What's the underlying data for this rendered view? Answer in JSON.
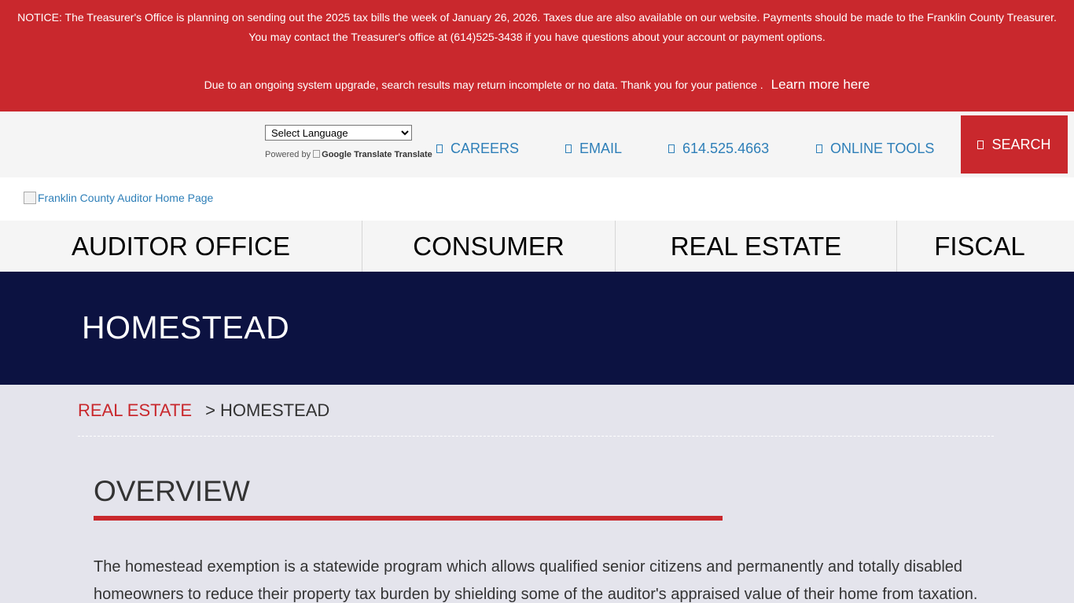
{
  "notice": {
    "line1": "NOTICE: The Treasurer's Office is planning on sending out the 2025 tax bills the week of January 26, 2026. Taxes due are also available on our website. Payments should be made to the Franklin County Treasurer.",
    "line2": "You may contact the Treasurer's office at (614)525-3438 if you have questions about your account or payment options.",
    "line3": "Due to an ongoing system upgrade, search results may return incomplete or no data.  Thank you for your patience .",
    "link": "Learn more here",
    "bg_color": "#c9282d"
  },
  "translate": {
    "select_value": "Select Language",
    "powered_by": "Powered by",
    "google_alt": "Google Translate",
    "translate_label": "Translate"
  },
  "util_links": {
    "careers": "CAREERS",
    "email": "EMAIL",
    "phone": "614.525.4663",
    "online_tools": "ONLINE TOOLS",
    "search": "SEARCH",
    "icon": "icon-placeholder"
  },
  "logo": {
    "alt": "Franklin County Auditor Home Page"
  },
  "nav": {
    "auditor_office": "AUDITOR OFFICE",
    "consumer": "CONSUMER",
    "real_estate": "REAL ESTATE",
    "fiscal": "FISCAL"
  },
  "hero": {
    "title": "HOMESTEAD",
    "bg_color": "#0c1241"
  },
  "breadcrumb": {
    "parent": "REAL ESTATE",
    "separator": ">",
    "current": "HOMESTEAD"
  },
  "content": {
    "section_title": "OVERVIEW",
    "paragraph": "The homestead exemption is a statewide program which allows qualified senior citizens and permanently and totally disabled homeowners to reduce their property tax burden by shielding some of the auditor's appraised value of their home from taxation."
  }
}
